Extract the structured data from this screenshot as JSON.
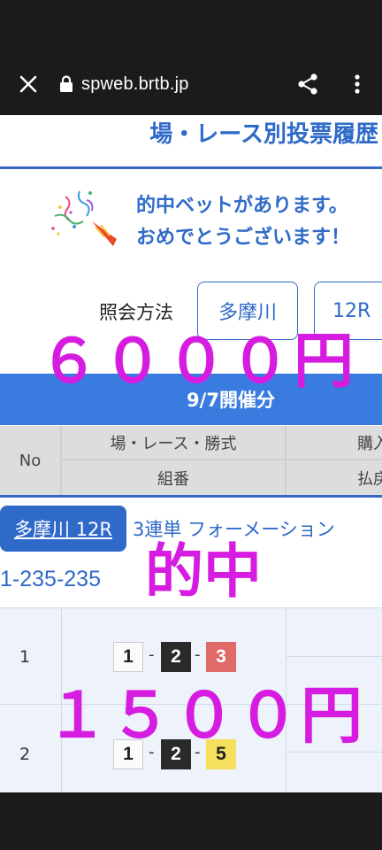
{
  "browser": {
    "url": "spweb.brtb.jp",
    "close_icon": "close-icon",
    "lock_icon": "lock-icon",
    "share_icon": "share-icon",
    "more_icon": "more-vert-icon"
  },
  "page": {
    "title": "場・レース別投票履歴",
    "congrats_line1": "的中ベットがあります。",
    "congrats_line2": "おめでとうございます！",
    "party_icon": "party-popper-icon",
    "query_label": "照会方法",
    "venue_button": "多摩川",
    "race_button": "12R",
    "date_header": "9/7開催分"
  },
  "table_header": {
    "no": "No",
    "venue_race_type": "場・レース・勝式",
    "purchase": "購入",
    "combination": "組番",
    "payout": "払戻"
  },
  "bet": {
    "badge": "多摩川 12R",
    "type": "3連単 フォーメーション",
    "combo": "1-235-235",
    "rows": [
      {
        "no": "1",
        "numbers": [
          "1",
          "2",
          "3"
        ]
      },
      {
        "no": "2",
        "numbers": [
          "1",
          "2",
          "5"
        ]
      }
    ]
  },
  "overlay": {
    "amount_top": "６０００円",
    "hit": "的中",
    "amount_bottom": "１５００円",
    "color": "#d61ce0"
  },
  "colors": {
    "accent": "#2f6ac8",
    "date_bar": "#3a7be0"
  }
}
